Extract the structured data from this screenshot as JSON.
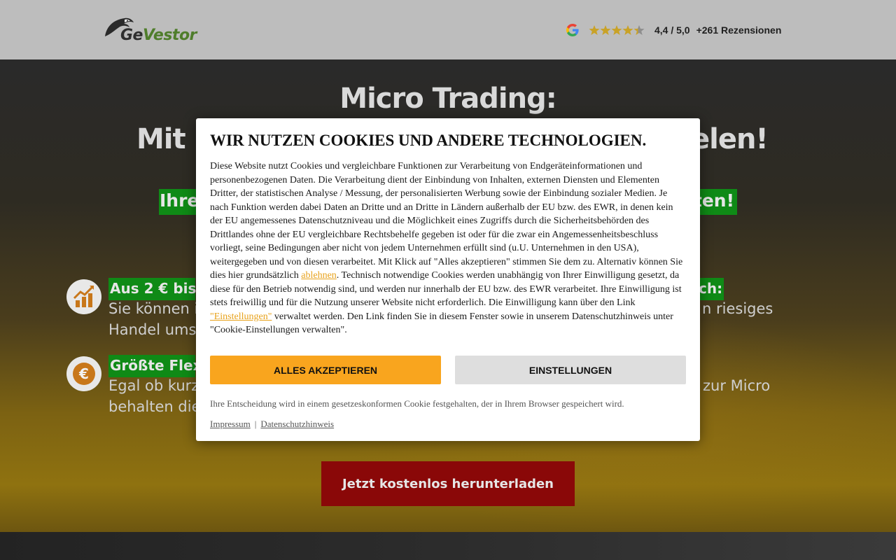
{
  "header": {
    "logo_text_1": "Ge",
    "logo_text_2": "Vestor",
    "rating_value": "4,4 / 5,0",
    "reviews": "+261 Rezensionen",
    "stars_filled": 4.4,
    "stars_total": 5,
    "google_icon": "google-icon"
  },
  "hero": {
    "title_line1": "Micro Trading:",
    "title_line2_left": "Mit k",
    "title_line2_right": "elen!",
    "subtitle_left": "Ihre",
    "subtitle_right": "aten!",
    "feature1": {
      "icon": "chart-up-icon",
      "heading_left": "Aus 2 € bis",
      "heading_right": "ch:",
      "text_l1_left": "Sie können i",
      "text_l1_right": "n riesiges",
      "text_l2_left": "Handel umse"
    },
    "feature2": {
      "icon": "euro-coin-icon",
      "heading_left": "Größte Flex",
      "text_l1_left": "Egal ob kurz",
      "text_l1_right": "g zur Micro",
      "text_l2_left": "behalten die"
    },
    "cta_label": "Jetzt kostenlos herunterladen"
  },
  "cookie": {
    "title": "WIR NUTZEN COOKIES UND ANDERE TECHNOLOGIEN.",
    "body_part1": "Diese Website nutzt Cookies und vergleichbare Funktionen zur Verarbeitung von Endgeräteinformationen und personenbezogenen Daten. Die Verarbeitung dient der Einbindung von Inhalten, externen Diensten und Elementen Dritter, der statistischen Analyse / Messung, der personalisierten Werbung sowie der Einbindung sozialer Medien. Je nach Funktion werden dabei Daten an Dritte und an Dritte in Ländern außerhalb der EU bzw. des EWR, in denen kein der EU angemessenes Datenschutzniveau und die Möglichkeit eines Zugriffs durch die Sicherheitsbehörden des Drittlandes ohne der EU vergleichbare Rechtsbehelfe gegeben ist oder für die zwar ein Angemessenheitsbeschluss vorliegt, seine Bedingungen aber nicht von jedem Unternehmen erfüllt sind (u.U. Unternehmen in den USA), weitergegeben und von diesen verarbeitet. Mit Klick auf \"Alles akzeptieren\" stimmen Sie dem zu. Alternativ können Sie dies hier grundsätzlich ",
    "link_reject": "ablehnen",
    "body_part2": ". Technisch notwendige Cookies werden unabhängig von Ihrer Einwilligung gesetzt, da diese für den Betrieb notwendig sind, und werden nur innerhalb der EU bzw. des EWR verarbeitet. Ihre Einwilligung ist stets freiwillig und für die Nutzung unserer Website nicht erforderlich. Die Einwilligung kann über den Link ",
    "link_settings": "\"Einstellungen\"",
    "body_part3": " verwaltet werden. Den Link finden Sie in diesem Fenster sowie in unserem Datenschutzhinweis unter \"Cookie-Einstellungen verwalten\".",
    "accept_label": "ALLES AKZEPTIEREN",
    "settings_label": "EINSTELLUNGEN",
    "note": "Ihre Entscheidung wird in einem gesetzeskonformen Cookie festgehalten, der in Ihrem Browser gespeichert wird.",
    "link_impressum": "Impressum",
    "separator": "|",
    "link_privacy": "Datenschutzhinweis",
    "accent_color": "#f9a51e"
  }
}
